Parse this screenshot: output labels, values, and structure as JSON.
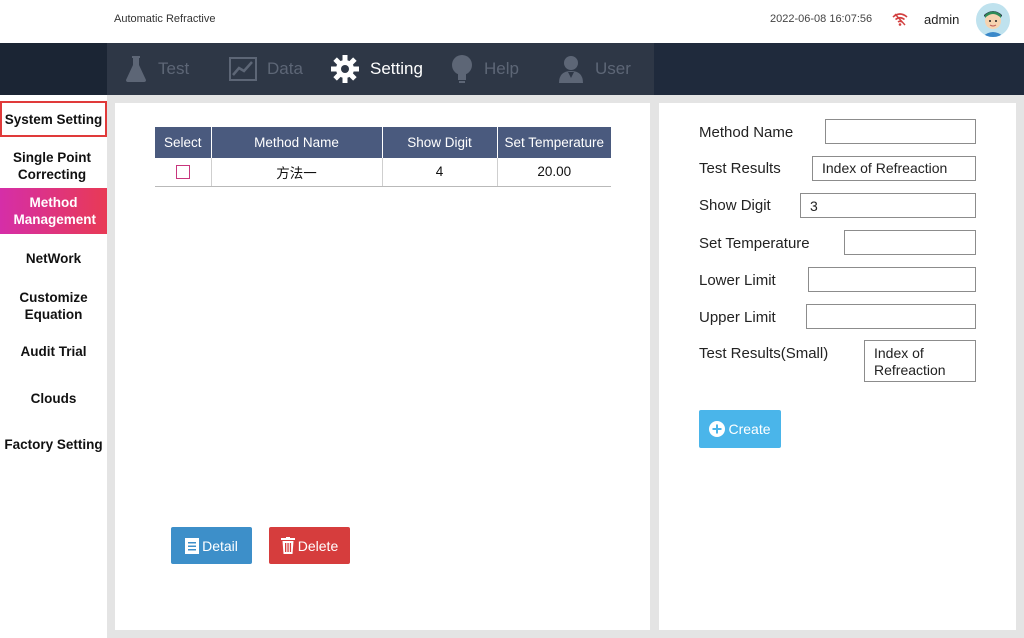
{
  "header": {
    "app_title": "Automatic Refractive",
    "datetime": "2022-06-08 16:07:56",
    "username": "admin"
  },
  "nav": {
    "tabs": [
      {
        "label": "Test",
        "icon": "flask-icon",
        "active": false
      },
      {
        "label": "Data",
        "icon": "line-chart-icon",
        "active": false
      },
      {
        "label": "Setting",
        "icon": "gear-icon",
        "active": true
      },
      {
        "label": "Help",
        "icon": "lightbulb-icon",
        "active": false
      },
      {
        "label": "User",
        "icon": "user-icon",
        "active": false
      }
    ]
  },
  "sidebar": {
    "items": [
      {
        "label": "System Setting"
      },
      {
        "label": "Single Point Correcting"
      },
      {
        "label": "Method Management"
      },
      {
        "label": "NetWork"
      },
      {
        "label": "Customize Equation"
      },
      {
        "label": "Audit Trial"
      },
      {
        "label": "Clouds"
      },
      {
        "label": "Factory Setting"
      }
    ]
  },
  "table": {
    "headers": [
      "Select",
      "Method Name",
      "Show Digit",
      "Set Temperature"
    ],
    "rows": [
      {
        "method_name": "方法一",
        "show_digit": "4",
        "set_temperature": "20.00"
      }
    ]
  },
  "buttons": {
    "detail": "Detail",
    "delete": "Delete",
    "create": "Create"
  },
  "form": {
    "method_name_label": "Method Name",
    "method_name_value": "",
    "test_results_label": "Test Results",
    "test_results_value": "Index of Refreaction",
    "show_digit_label": "Show Digit",
    "show_digit_value": "3",
    "set_temperature_label": "Set Temperature",
    "set_temperature_value": "",
    "lower_limit_label": "Lower Limit",
    "lower_limit_value": "",
    "upper_limit_label": "Upper Limit",
    "upper_limit_value": "",
    "test_results_small_label": "Test Results(Small)",
    "test_results_small_value": "Index of Refreaction"
  },
  "colors": {
    "nav_dark": "#1f2a3c",
    "header_row": "#4a5a7e",
    "active_gradient_start": "#d52ea8",
    "active_gradient_end": "#e83a55",
    "highlight_border": "#e03a3a",
    "detail_button": "#3d8fc9",
    "delete_button": "#d63d3d",
    "create_button": "#4ab5ea"
  }
}
